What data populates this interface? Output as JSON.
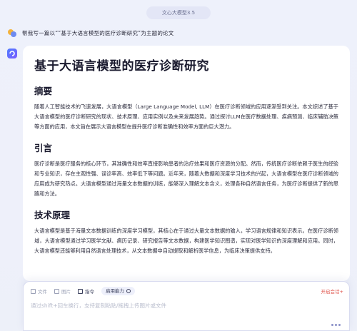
{
  "header": {
    "model_name": "文心大模型3.5"
  },
  "user_message": {
    "text": "帮我写一篇以“”基于大语言模型的医疗诊断研究”为主题的论文"
  },
  "answer": {
    "title": "基于大语言模型的医疗诊断研究",
    "sections": [
      {
        "heading": "摘要",
        "body": "随着人工智能技术的飞速发展，大语言模型（Large Language Model, LLM）在医疗诊断领域的应用逐渐受到关注。本文综述了基于大语言模型的医疗诊断研究的现状、技术原理、应用实例以及未来发展趋势。通过探讨LLM在医疗数据处理、疾病预测、临床辅助决策等方面的应用，本文旨在展示大语言模型在提升医疗诊断准确性和效率方面的巨大潜力。"
      },
      {
        "heading": "引言",
        "body": "医疗诊断是医疗服务的核心环节，其准确性和效率直接影响患者的治疗效果和医疗资源的分配。然而，传统医疗诊断依赖于医生的经验和专业知识，存在主观性强、误诊率高、效率低下等问题。近年来，随着大数据和深度学习技术的兴起，大语言模型在医疗诊断领域的应用成为研究热点。大语言模型通过海量文本数据的训练，能够深入理解文本含义，处理各种自然语言任务，为医疗诊断提供了新的思路和方法。"
      },
      {
        "heading": "技术原理",
        "body": "大语言模型是基于海量文本数据训练的深度学习模型，其核心在于通过大量文本数据的输入，学习语言规律和知识表示。在医疗诊断领域，大语言模型通过学习医学文献、病历记录、研究报告等文本数据，构建医学知识图谱，实现对医学知识的深度理解和应用。同时，大语言模型还能够利用自然语言处理技术，从文本数据中自动提取和解析医学信息，为临床决策提供支持。"
      }
    ]
  },
  "composer": {
    "tools": [
      {
        "label": "文件",
        "icon": "file-icon"
      },
      {
        "label": "图片",
        "icon": "image-icon"
      },
      {
        "label": "指令",
        "icon": "command-icon"
      }
    ],
    "plugin_label": "启用能力",
    "new_chat_label": "开启会话+",
    "placeholder": "通过shift+回车换行，支持复制粘贴/拖拽上传图片或文件"
  }
}
